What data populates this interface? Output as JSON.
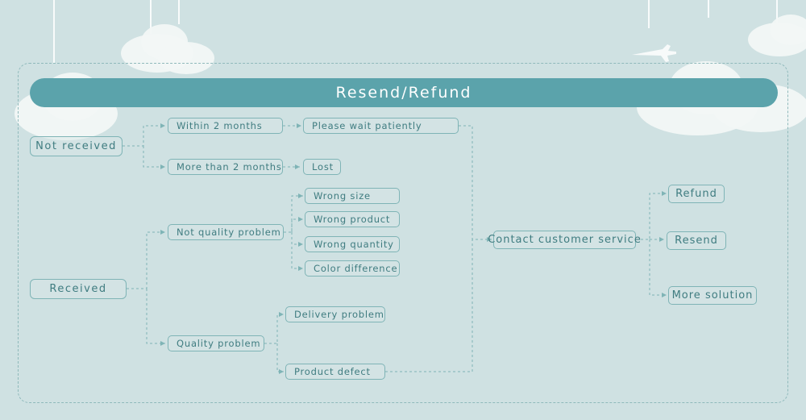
{
  "page": {
    "background_color": "#cfe1e2",
    "accent_color": "#5ba3ab",
    "text_color": "#3f7c80",
    "border_color": "#7fb4b6"
  },
  "header": {
    "title": "Resend/Refund"
  },
  "nodes": {
    "not_received": "Not received",
    "received": "Received",
    "within_2_months": "Within 2 months",
    "more_than_2_months": "More than 2 months",
    "please_wait": "Please wait patiently",
    "lost": "Lost",
    "not_quality_problem": "Not quality problem",
    "quality_problem": "Quality problem",
    "wrong_size": "Wrong size",
    "wrong_product": "Wrong product",
    "wrong_quantity": "Wrong quantity",
    "color_difference": "Color difference",
    "delivery_problem": "Delivery problem",
    "product_defect": "Product defect",
    "contact_customer_service": "Contact customer service",
    "refund": "Refund",
    "resend": "Resend",
    "more_solution": "More solution"
  }
}
